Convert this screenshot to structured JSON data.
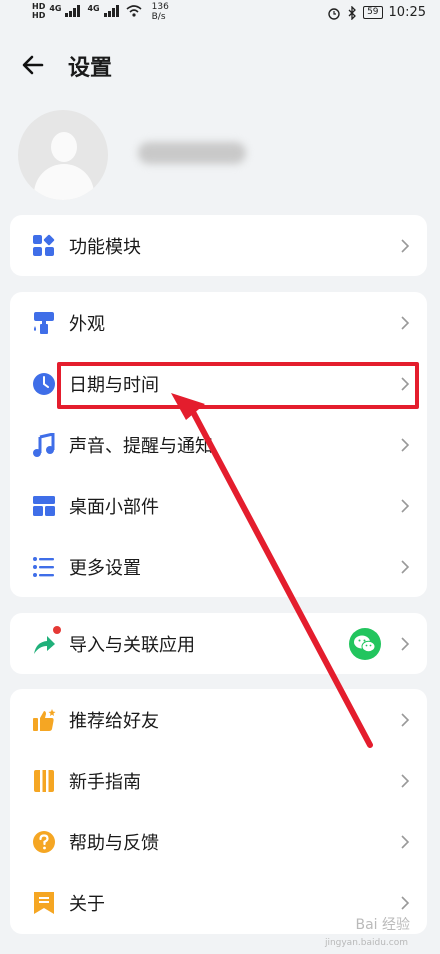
{
  "status_bar": {
    "net_left_1": "HD",
    "net_left_2": "HD",
    "gen_1": "4G",
    "gen_2": "4G",
    "speed_value": "136",
    "speed_unit": "B/s",
    "battery": "59",
    "time": "10:25"
  },
  "header": {
    "title": "设置"
  },
  "groups": [
    {
      "items": [
        {
          "label": "功能模块",
          "icon": "grid-icon",
          "color": "#3f6ee8"
        }
      ]
    },
    {
      "items": [
        {
          "label": "外观",
          "icon": "paint-roller-icon",
          "color": "#3f6ee8"
        },
        {
          "label": "日期与时间",
          "icon": "clock-icon",
          "color": "#3f6ee8"
        },
        {
          "label": "声音、提醒与通知",
          "icon": "music-note-icon",
          "color": "#3f6ee8"
        },
        {
          "label": "桌面小部件",
          "icon": "widget-layout-icon",
          "color": "#3f6ee8"
        },
        {
          "label": "更多设置",
          "icon": "list-settings-icon",
          "color": "#3f6ee8"
        }
      ]
    },
    {
      "items": [
        {
          "label": "导入与关联应用",
          "icon": "share-arrow-icon",
          "color": "#20b07a",
          "badge": "wechat-icon"
        }
      ]
    },
    {
      "items": [
        {
          "label": "推荐给好友",
          "icon": "thumbs-up-icon",
          "color": "#f5a623"
        },
        {
          "label": "新手指南",
          "icon": "guide-book-icon",
          "color": "#f5a623"
        },
        {
          "label": "帮助与反馈",
          "icon": "help-circle-icon",
          "color": "#f5a623"
        },
        {
          "label": "关于",
          "icon": "bookmark-flag-icon",
          "color": "#f5a623"
        }
      ]
    }
  ],
  "annotation": {
    "color": "#e41d2d"
  },
  "watermark": {
    "text": "Bai 经验",
    "sub": "jingyan.baidu.com"
  }
}
